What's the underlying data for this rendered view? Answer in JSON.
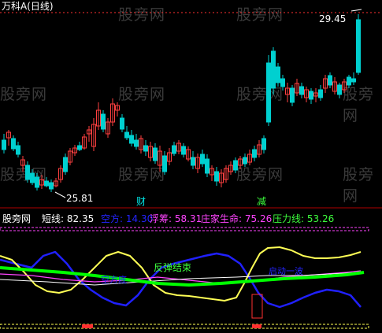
{
  "window": {
    "title": "万科A(日线)"
  },
  "watermark": "股旁网",
  "price_panel": {
    "high_label": "29.45",
    "low_label": "25.81",
    "markers": [
      {
        "text": "财",
        "color": "#00e5e5"
      },
      {
        "text": "减",
        "color": "#3dff3d"
      }
    ]
  },
  "indicator_header": {
    "name": "股旁网",
    "items": [
      {
        "label": "短线:",
        "value": "82.35",
        "color": "#ffffff"
      },
      {
        "label": "空方:",
        "value": "14.30",
        "color": "#2424ff"
      },
      {
        "label": "浮筹:",
        "value": "58.31",
        "color": "#ff44ff"
      },
      {
        "label": "庄家生命:",
        "value": "75.26",
        "color": "#ff44ff"
      },
      {
        "label": "压力线:",
        "value": "53.26",
        "color": "#3dff3d"
      }
    ]
  },
  "indicator_annotations": [
    {
      "text": "反弹结束",
      "color": "#3dff3d"
    },
    {
      "text": "空方底",
      "color": "#2424ff"
    },
    {
      "text": "启动一波",
      "color": "#2424ff"
    }
  ],
  "colors": {
    "up": "#ff4040",
    "down": "#00d0d0",
    "short": "#ffff55",
    "bear": "#2020ff",
    "float": "#ff44ff",
    "life": "#ffffff",
    "press": "#00ff00"
  }
}
